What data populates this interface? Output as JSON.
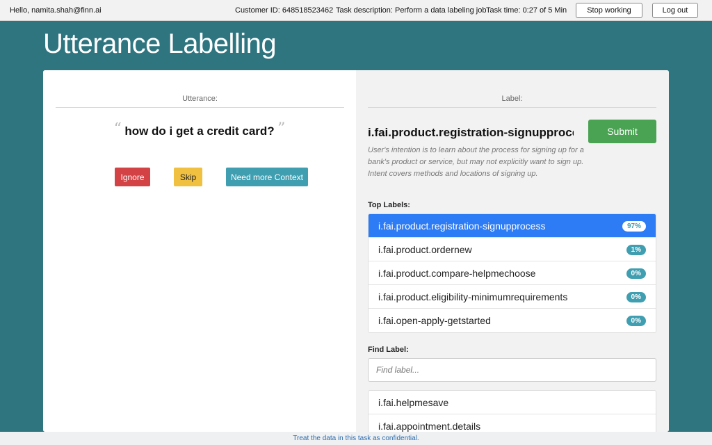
{
  "topbar": {
    "greeting": "Hello, namita.shah@finn.ai",
    "customer_id": "Customer ID: 648518523462",
    "task_description": "Task description: Perform a data labeling job",
    "task_time": "Task time: 0:27 of 5 Min",
    "stop_label": "Stop working",
    "logout_label": "Log out"
  },
  "page": {
    "title": "Utterance Labelling"
  },
  "utterance_panel": {
    "heading": "Utterance:",
    "open_quote": "“",
    "close_quote": "”",
    "text": "how do i get a credit card?",
    "ignore_label": "Ignore",
    "skip_label": "Skip",
    "context_label": "Need more Context"
  },
  "label_panel": {
    "heading": "Label:",
    "selected_label": "i.fai.product.registration-signupprocess",
    "submit_label": "Submit",
    "description": "User's intention is to learn about the process for signing up for a bank's product or service, but may not explicitly want to sign up. Intent covers methods and locations of signing up.",
    "top_labels_heading": "Top Labels:",
    "top_labels": [
      {
        "label": "i.fai.product.registration-signupprocess",
        "score": "97%"
      },
      {
        "label": "i.fai.product.ordernew",
        "score": "1%"
      },
      {
        "label": "i.fai.product.compare-helpmechoose",
        "score": "0%"
      },
      {
        "label": "i.fai.product.eligibility-minimumrequirements",
        "score": "0%"
      },
      {
        "label": "i.fai.open-apply-getstarted",
        "score": "0%"
      }
    ],
    "find_heading": "Find Label:",
    "find_placeholder": "Find label...",
    "find_results": [
      {
        "label": "i.fai.helpmesave"
      },
      {
        "label": "i.fai.appointment.details"
      }
    ]
  },
  "footer": {
    "text": "Treat the data in this task as confidential."
  },
  "colors": {
    "background": "#2f7580",
    "active_item": "#2d7cf5",
    "badge": "#3f9eb0",
    "submit": "#4aa352",
    "ignore": "#d34245",
    "skip": "#f0c040",
    "context": "#3f9eb0"
  }
}
